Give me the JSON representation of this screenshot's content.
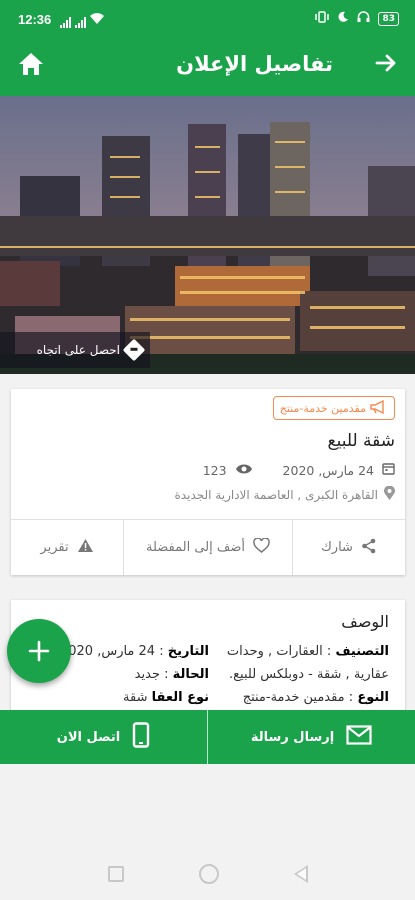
{
  "status": {
    "time": "12:36",
    "battery": "83"
  },
  "appbar": {
    "title": "تفاصيل الإعلان"
  },
  "hero": {
    "directions_label": "احصل على اتجاه"
  },
  "ad": {
    "tag": "مقدمين خدمة-منتج",
    "title": "شقة للبيع",
    "date": "24 مارس, 2020",
    "views": "123",
    "location": "القاهرة الكبرى , العاصمة الادارية الجديدة",
    "actions": {
      "share": "شارك",
      "favorite": "أضف إلى المفضلة",
      "report": "تقرير"
    }
  },
  "description": {
    "title": "الوصف",
    "category_label": "التصنيف",
    "category_value": ": العقارات , وحدات عقارية , شقة - دوبلكس للبيع.",
    "type_label": "النوع",
    "type_value": ": مقدمين خدمة-منتج",
    "date_label": "التاريخ",
    "date_value": ": 24 مارس, 2020",
    "condition_label": "الحالة",
    "condition_value": ": جديد",
    "property_type_label": "نوع العقا",
    "property_type_value": "شقة"
  },
  "bottom": {
    "message": "إرسال رسالة",
    "call": "اتصل الان"
  },
  "colors": {
    "primary": "#1aa34a",
    "accent": "#f5894e"
  }
}
